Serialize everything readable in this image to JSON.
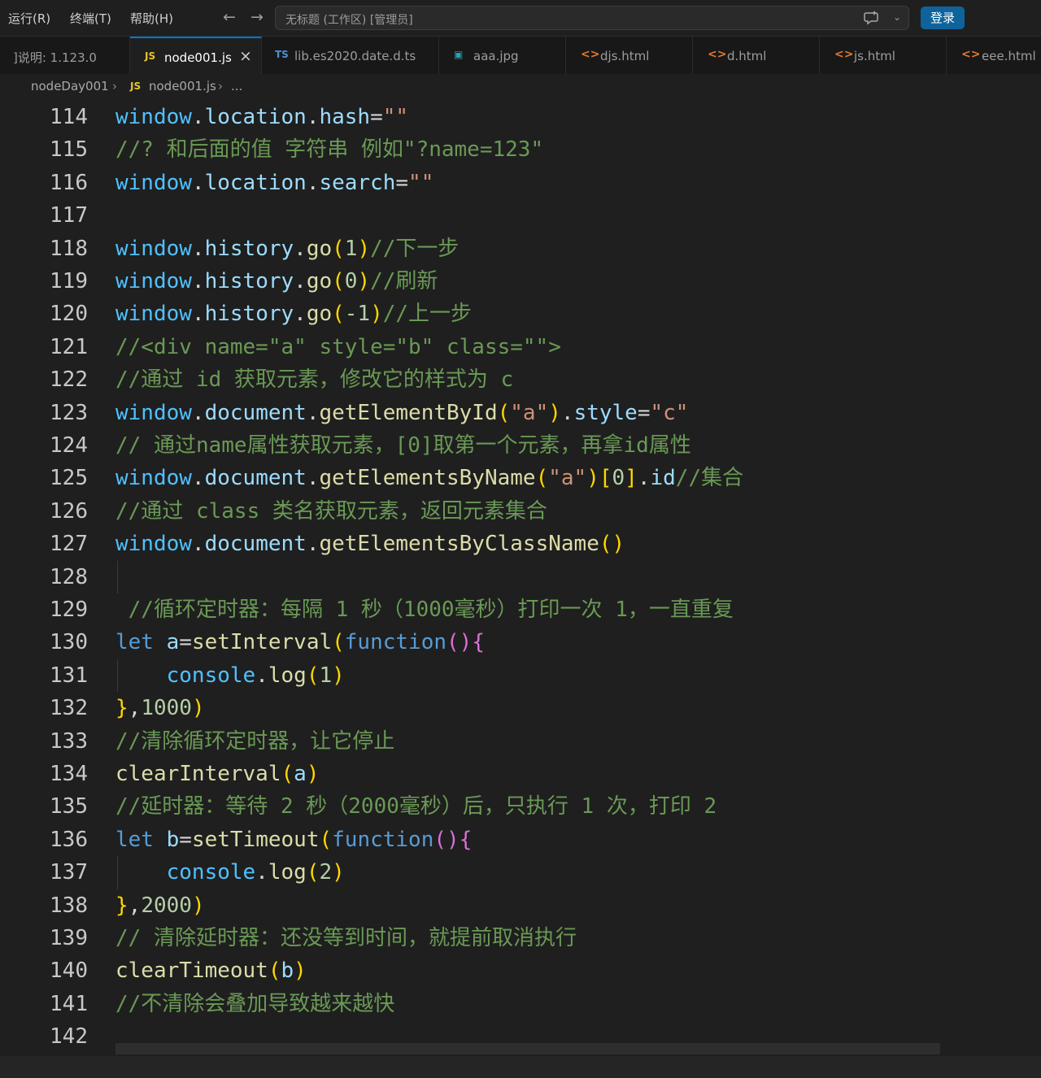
{
  "menu": {
    "items": [
      "运行(R)",
      "终端(T)",
      "帮助(H)"
    ]
  },
  "title_bar": {
    "command_center_text": "无标题 (工作区) [管理员]",
    "login_label": "登录"
  },
  "colors": {
    "accent": "#0078d4",
    "login_button": "#0e639c",
    "background": "#1f1f1f"
  },
  "tabs": [
    {
      "label": "]说明: 1.123.0",
      "icon": "",
      "active": false
    },
    {
      "label": "node001.js",
      "icon": "js-file-icon",
      "active": true
    },
    {
      "label": "lib.es2020.date.d.ts",
      "icon": "ts-file-icon",
      "active": false
    },
    {
      "label": "aaa.jpg",
      "icon": "image-file-icon",
      "active": false
    },
    {
      "label": "djs.html",
      "icon": "html-file-icon",
      "active": false
    },
    {
      "label": "d.html",
      "icon": "html-file-icon",
      "active": false
    },
    {
      "label": "js.html",
      "icon": "html-file-icon",
      "active": false
    },
    {
      "label": "eee.html",
      "icon": "html-file-icon",
      "active": false
    }
  ],
  "breadcrumb": {
    "folder": "nodeDay001",
    "file": "node001.js",
    "more": "..."
  },
  "editor": {
    "lines": [
      {
        "n": "114",
        "text": "window.location.hash=\"\""
      },
      {
        "n": "115",
        "text": "//? 和后面的值 字符串 例如\"?name=123\""
      },
      {
        "n": "116",
        "text": "window.location.search=\"\""
      },
      {
        "n": "117",
        "text": ""
      },
      {
        "n": "118",
        "text": "window.history.go(1)//下一步"
      },
      {
        "n": "119",
        "text": "window.history.go(0)//刷新"
      },
      {
        "n": "120",
        "text": "window.history.go(-1)//上一步"
      },
      {
        "n": "121",
        "text": "//<div name=\"a\" style=\"b\" class=\"\">"
      },
      {
        "n": "122",
        "text": "//通过 id 获取元素，修改它的样式为 c"
      },
      {
        "n": "123",
        "text": "window.document.getElementById(\"a\").style=\"c\""
      },
      {
        "n": "124",
        "text": "// 通过name属性获取元素，[0]取第一个元素，再拿id属性"
      },
      {
        "n": "125",
        "text": "window.document.getElementsByName(\"a\")[0].id//集合"
      },
      {
        "n": "126",
        "text": "//通过 class 类名获取元素，返回元素集合"
      },
      {
        "n": "127",
        "text": "window.document.getElementsByClassName()"
      },
      {
        "n": "128",
        "text": ""
      },
      {
        "n": "129",
        "text": " //循环定时器：每隔 1 秒（1000毫秒）打印一次 1，一直重复"
      },
      {
        "n": "130",
        "text": "let a=setInterval(function(){"
      },
      {
        "n": "131",
        "text": "    console.log(1)"
      },
      {
        "n": "132",
        "text": "},1000)"
      },
      {
        "n": "133",
        "text": "//清除循环定时器，让它停止"
      },
      {
        "n": "134",
        "text": "clearInterval(a)"
      },
      {
        "n": "135",
        "text": "//延时器：等待 2 秒（2000毫秒）后，只执行 1 次，打印 2"
      },
      {
        "n": "136",
        "text": "let b=setTimeout(function(){"
      },
      {
        "n": "137",
        "text": "    console.log(2)"
      },
      {
        "n": "138",
        "text": "},2000)"
      },
      {
        "n": "139",
        "text": "// 清除延时器：还没等到时间，就提前取消执行"
      },
      {
        "n": "140",
        "text": "clearTimeout(b)"
      },
      {
        "n": "141",
        "text": "//不清除会叠加导致越来越快"
      },
      {
        "n": "142",
        "text": ""
      }
    ]
  }
}
